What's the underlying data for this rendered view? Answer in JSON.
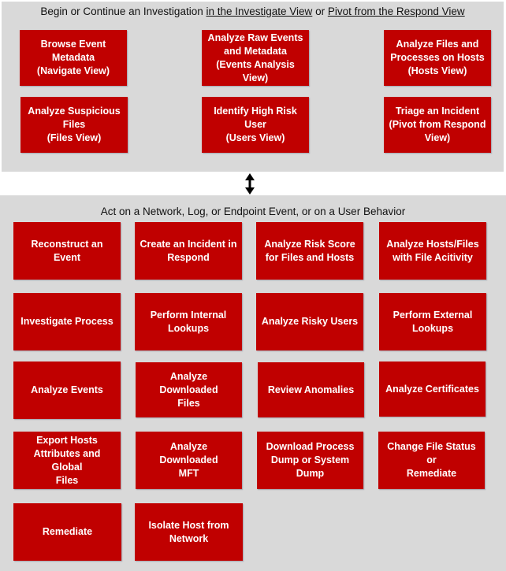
{
  "top_panel": {
    "title_plain_1": "Begin or Continue an Investigation ",
    "title_link_1": "in the Investigate View",
    "title_plain_2": " or ",
    "title_link_2": "Pivot from the Respond View",
    "boxes": [
      {
        "label": "Browse Event\nMetadata\n(Navigate View)"
      },
      {
        "label": "Analyze Raw Events\nand Metadata\n(Events Analysis\nView)"
      },
      {
        "label": "Analyze Files and\nProcesses on Hosts\n(Hosts View)"
      },
      {
        "label": "Analyze Suspicious\nFiles\n(Files View)"
      },
      {
        "label": "Identify High Risk\nUser\n(Users View)"
      },
      {
        "label": "Triage an Incident\n(Pivot from Respond\nView)"
      }
    ]
  },
  "connector": {
    "icon": "double-headed-vertical-arrow"
  },
  "bottom_panel": {
    "title": "Act on a Network, Log, or Endpoint Event, or on a User Behavior",
    "boxes": [
      {
        "label": "Reconstruct an Event"
      },
      {
        "label": "Create an Incident in\nRespond"
      },
      {
        "label": "Analyze Risk Score\nfor Files and Hosts"
      },
      {
        "label": "Analyze Hosts/Files\nwith File Acitivity"
      },
      {
        "label": "Investigate Process"
      },
      {
        "label": "Perform Internal\nLookups"
      },
      {
        "label": "Analyze Risky Users"
      },
      {
        "label": "Perform External\nLookups"
      },
      {
        "label": "Analyze Events"
      },
      {
        "label": "Analyze Downloaded\nFiles"
      },
      {
        "label": "Review Anomalies"
      },
      {
        "label": "Analyze Certificates"
      },
      {
        "label": "Export Hosts\nAttributes and Global\nFiles"
      },
      {
        "label": "Analyze Downloaded\nMFT"
      },
      {
        "label": "Download Process\nDump or System\nDump"
      },
      {
        "label": "Change File Status or\nRemediate"
      },
      {
        "label": "Remediate"
      },
      {
        "label": "Isolate Host from\nNetwork"
      }
    ]
  },
  "colors": {
    "box_fill": "#c00000",
    "box_text": "#ffffff",
    "panel_fill": "#d9d9d9"
  }
}
